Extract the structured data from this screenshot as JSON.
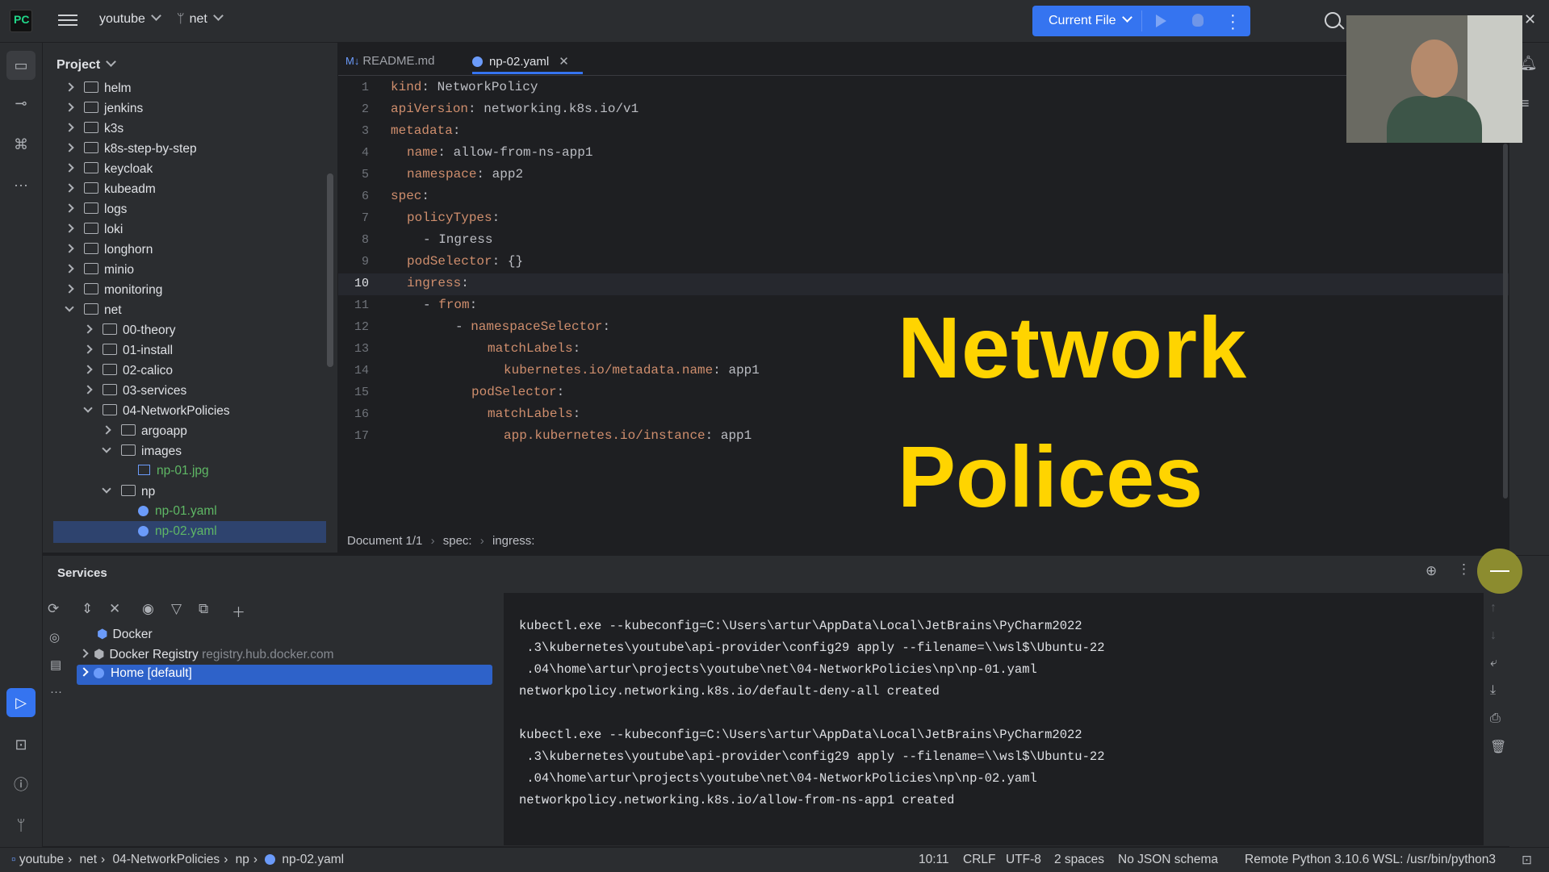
{
  "titlebar": {
    "project": "youtube",
    "branch": "net",
    "run_config": "Current File"
  },
  "project_panel": {
    "title": "Project",
    "tree": [
      {
        "label": "helm",
        "depth": 0,
        "type": "folder",
        "open": false
      },
      {
        "label": "jenkins",
        "depth": 0,
        "type": "folder",
        "open": false
      },
      {
        "label": "k3s",
        "depth": 0,
        "type": "folder",
        "open": false
      },
      {
        "label": "k8s-step-by-step",
        "depth": 0,
        "type": "folder",
        "open": false
      },
      {
        "label": "keycloak",
        "depth": 0,
        "type": "folder",
        "open": false
      },
      {
        "label": "kubeadm",
        "depth": 0,
        "type": "folder",
        "open": false
      },
      {
        "label": "logs",
        "depth": 0,
        "type": "folder",
        "open": false
      },
      {
        "label": "loki",
        "depth": 0,
        "type": "folder",
        "open": false
      },
      {
        "label": "longhorn",
        "depth": 0,
        "type": "folder",
        "open": false
      },
      {
        "label": "minio",
        "depth": 0,
        "type": "folder",
        "open": false
      },
      {
        "label": "monitoring",
        "depth": 0,
        "type": "folder",
        "open": false
      },
      {
        "label": "net",
        "depth": 0,
        "type": "folder",
        "open": true
      },
      {
        "label": "00-theory",
        "depth": 1,
        "type": "folder",
        "open": false
      },
      {
        "label": "01-install",
        "depth": 1,
        "type": "folder",
        "open": false
      },
      {
        "label": "02-calico",
        "depth": 1,
        "type": "folder",
        "open": false
      },
      {
        "label": "03-services",
        "depth": 1,
        "type": "folder",
        "open": false
      },
      {
        "label": "04-NetworkPolicies",
        "depth": 1,
        "type": "folder",
        "open": true
      },
      {
        "label": "argoapp",
        "depth": 2,
        "type": "folder",
        "open": false
      },
      {
        "label": "images",
        "depth": 2,
        "type": "folder",
        "open": true
      },
      {
        "label": "np-01.jpg",
        "depth": 3,
        "type": "image"
      },
      {
        "label": "np",
        "depth": 2,
        "type": "folder",
        "open": true
      },
      {
        "label": "np-01.yaml",
        "depth": 3,
        "type": "yaml"
      },
      {
        "label": "np-02.yaml",
        "depth": 3,
        "type": "yaml",
        "selected": true
      }
    ]
  },
  "editor": {
    "tabs": [
      {
        "label": "README.md",
        "prefix": "M↓",
        "active": false
      },
      {
        "label": "np-02.yaml",
        "active": true
      }
    ],
    "current_line": 10,
    "lines": [
      {
        "n": "1",
        "indent": 0,
        "key": "kind",
        "val": " NetworkPolicy"
      },
      {
        "n": "2",
        "indent": 0,
        "key": "apiVersion",
        "val": " networking.k8s.io/v1"
      },
      {
        "n": "3",
        "indent": 0,
        "key": "metadata",
        "val": ""
      },
      {
        "n": "4",
        "indent": 1,
        "key": "name",
        "val": " allow-from-ns-app1"
      },
      {
        "n": "5",
        "indent": 1,
        "key": "namespace",
        "val": " app2"
      },
      {
        "n": "6",
        "indent": 0,
        "key": "spec",
        "val": ""
      },
      {
        "n": "7",
        "indent": 1,
        "key": "policyTypes",
        "val": ""
      },
      {
        "n": "8",
        "indent": 2,
        "key": "",
        "val": "- Ingress"
      },
      {
        "n": "9",
        "indent": 1,
        "key": "podSelector",
        "val": " {}"
      },
      {
        "n": "10",
        "indent": 1,
        "key": "ingress",
        "val": ""
      },
      {
        "n": "11",
        "indent": 2,
        "dash": "- ",
        "key": "from",
        "val": ""
      },
      {
        "n": "12",
        "indent": 4,
        "dash": "- ",
        "key": "namespaceSelector",
        "val": ""
      },
      {
        "n": "13",
        "indent": 6,
        "key": "matchLabels",
        "val": ""
      },
      {
        "n": "14",
        "indent": 7,
        "key": "kubernetes.io/metadata.name",
        "val": " app1"
      },
      {
        "n": "15",
        "indent": 5,
        "key": "podSelector",
        "val": ""
      },
      {
        "n": "16",
        "indent": 6,
        "key": "matchLabels",
        "val": ""
      },
      {
        "n": "17",
        "indent": 7,
        "key": "app.kubernetes.io/instance",
        "val": " app1"
      }
    ],
    "breadcrumbs": [
      "Document 1/1",
      "spec:",
      "ingress:"
    ],
    "overlay_line1": "Network",
    "overlay_line2": "Polices"
  },
  "services": {
    "title": "Services",
    "items": [
      {
        "label": "Docker",
        "extra": ""
      },
      {
        "label": "Docker Registry",
        "extra": "registry.hub.docker.com"
      },
      {
        "label": "Home [default]",
        "extra": "",
        "selected": true
      }
    ],
    "console": [
      "kubectl.exe --kubeconfig=C:\\Users\\artur\\AppData\\Local\\JetBrains\\PyCharm2022",
      " .3\\kubernetes\\youtube\\api-provider\\config29 apply --filename=\\\\wsl$\\Ubuntu-22",
      " .04\\home\\artur\\projects\\youtube\\net\\04-NetworkPolicies\\np\\np-01.yaml",
      "networkpolicy.networking.k8s.io/default-deny-all created",
      "",
      "kubectl.exe --kubeconfig=C:\\Users\\artur\\AppData\\Local\\JetBrains\\PyCharm2022",
      " .3\\kubernetes\\youtube\\api-provider\\config29 apply --filename=\\\\wsl$\\Ubuntu-22",
      " .04\\home\\artur\\projects\\youtube\\net\\04-NetworkPolicies\\np\\np-02.yaml",
      "networkpolicy.networking.k8s.io/allow-from-ns-app1 created"
    ]
  },
  "statusbar": {
    "path": [
      "youtube",
      "net",
      "04-NetworkPolicies",
      "np",
      "np-02.yaml"
    ],
    "position": "10:11",
    "line_sep": "CRLF",
    "encoding": "UTF-8",
    "indent": "2 spaces",
    "schema": "No JSON schema",
    "interpreter": "Remote Python 3.10.6 WSL: /usr/bin/python3"
  },
  "colors": {
    "accent": "#3574f0",
    "yaml_key": "#cf8e6d",
    "overlay_text": "#ffd400"
  }
}
